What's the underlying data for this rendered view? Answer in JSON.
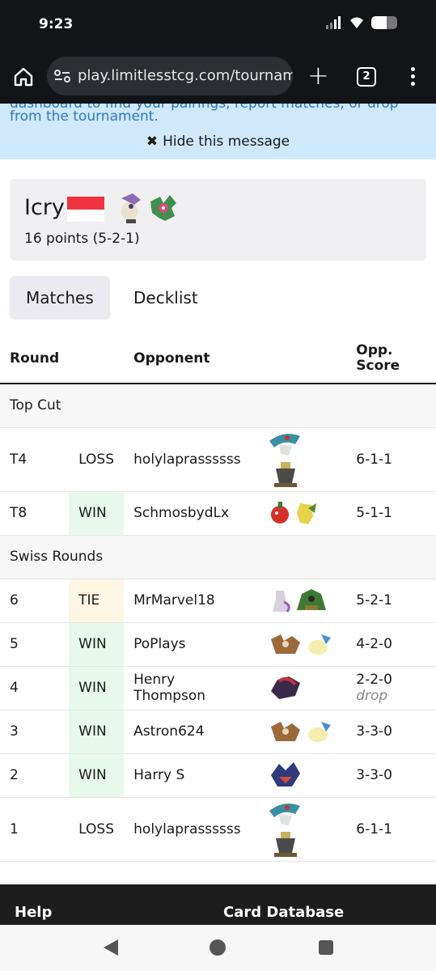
{
  "status_bar": {
    "time": "9:23",
    "signal_icon": "signal-icon",
    "wifi_icon": "wifi-icon",
    "battery_icon": "battery-icon"
  },
  "browser": {
    "url": "play.limitlesstcg.com/tournam",
    "tab_count": "2",
    "home_icon": "home-icon",
    "site_info_icon": "site-info-icon",
    "new_tab_icon": "plus-icon",
    "menu_icon": "more-vert-icon"
  },
  "notice": {
    "clipped_line": "dashboard to find your pairings, report matches, or drop",
    "line": "from the tournament.",
    "hide_icon": "✖",
    "hide_label": "Hide this message"
  },
  "player": {
    "name": "Icry",
    "flag": "singapore-flag",
    "points": "16 points (5-2-1)"
  },
  "tabs": [
    {
      "label": "Matches",
      "active": true
    },
    {
      "label": "Decklist",
      "active": false
    }
  ],
  "table": {
    "headers": {
      "round": "Round",
      "opponent": "Opponent",
      "opp_score_line1": "Opp.",
      "opp_score_line2": "Score"
    },
    "sections": [
      {
        "title": "Top Cut",
        "rows": [
          {
            "round": "T4",
            "result": "LOSS",
            "opponent": "holylaprassssss",
            "score": "6-1-1",
            "drop": ""
          },
          {
            "round": "T8",
            "result": "WIN",
            "opponent": "SchmosbydLx",
            "score": "5-1-1",
            "drop": ""
          }
        ]
      },
      {
        "title": "Swiss Rounds",
        "rows": [
          {
            "round": "6",
            "result": "TIE",
            "opponent": "MrMarvel18",
            "score": "5-2-1",
            "drop": ""
          },
          {
            "round": "5",
            "result": "WIN",
            "opponent": "PoPlays",
            "score": "4-2-0",
            "drop": ""
          },
          {
            "round": "4",
            "result": "WIN",
            "opponent": "Henry Thompson",
            "score": "2-2-0",
            "drop": "drop"
          },
          {
            "round": "3",
            "result": "WIN",
            "opponent": "Astron624",
            "score": "3-3-0",
            "drop": ""
          },
          {
            "round": "2",
            "result": "WIN",
            "opponent": "Harry S",
            "score": "3-3-0",
            "drop": ""
          },
          {
            "round": "1",
            "result": "LOSS",
            "opponent": "holylaprassssss",
            "score": "6-1-1",
            "drop": ""
          }
        ]
      }
    ]
  },
  "footer": {
    "help": "Help",
    "card_database": "Card Database"
  },
  "nav": {
    "back_icon": "back-icon",
    "home_icon": "home-circle-icon",
    "recents_icon": "recents-icon"
  },
  "colors": {
    "win_bg": "#e8f8ec",
    "tie_bg": "#fdf6e3",
    "notice_bg": "#cfe8fb",
    "notice_link": "#2e7bbf"
  }
}
